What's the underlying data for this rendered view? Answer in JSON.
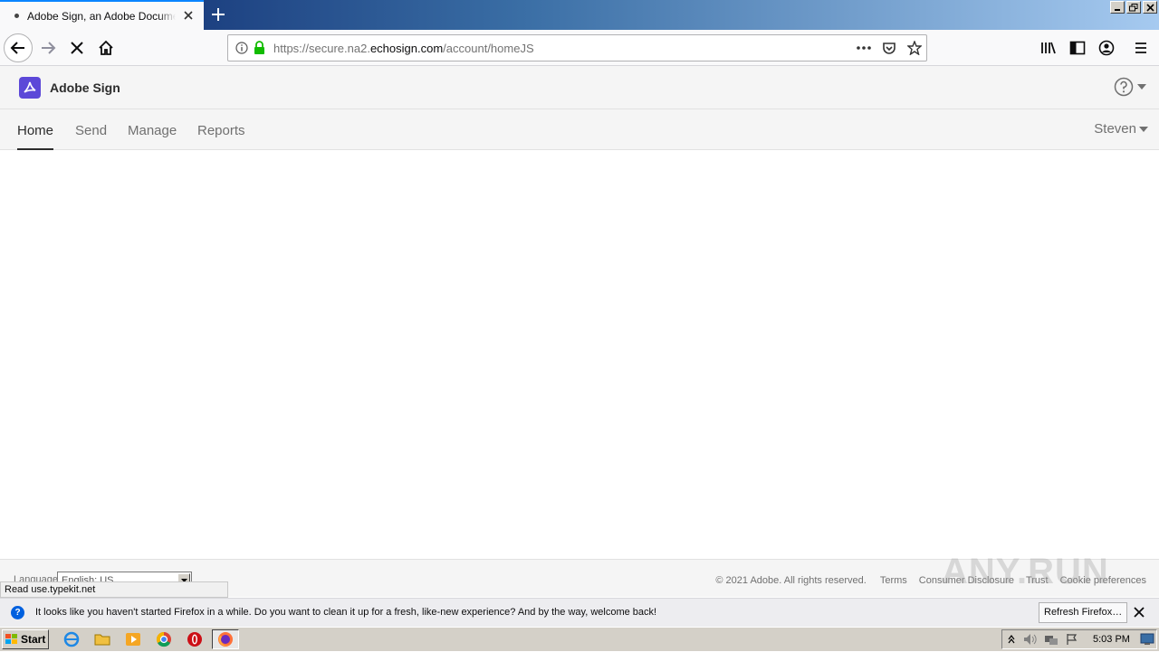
{
  "browser": {
    "tab_title": "Adobe Sign, an Adobe Document Cloud",
    "url_prefix": "https://secure.na2.",
    "url_host": "echosign.com",
    "url_path": "/account/homeJS",
    "status_tip": "Read use.typekit.net"
  },
  "app": {
    "brand": "Adobe Sign",
    "brand_color": "#5c48d8",
    "nav": {
      "home": "Home",
      "send": "Send",
      "manage": "Manage",
      "reports": "Reports"
    },
    "user": "Steven",
    "footer": {
      "language_label": "Language",
      "language_value": "English: US",
      "copyright": "© 2021 Adobe. All rights reserved.",
      "links": [
        "Terms",
        "Consumer Disclosure",
        "Trust",
        "Cookie preferences"
      ]
    }
  },
  "notification": {
    "text": "It looks like you haven't started Firefox in a while. Do you want to clean it up for a fresh, like-new experience? And by the way, welcome back!",
    "button": "Refresh Firefox…"
  },
  "taskbar": {
    "start": "Start",
    "clock": "5:03 PM"
  },
  "watermark": "ANY.RUN"
}
